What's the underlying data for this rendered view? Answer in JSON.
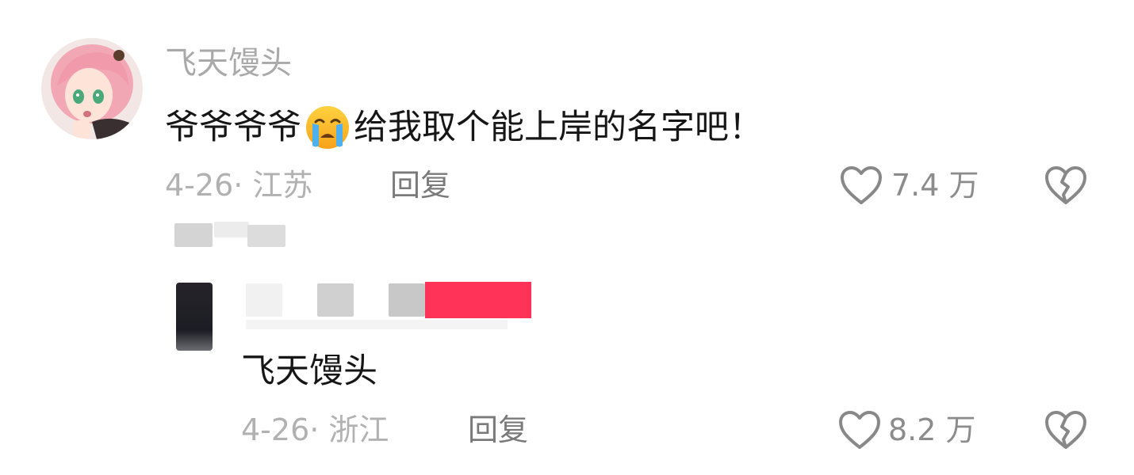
{
  "comment": {
    "username": "飞天馒头",
    "text_before": "爷爷爷爷",
    "emoji": "crying-face-emoji",
    "text_after": "给我取个能上岸的名字吧！",
    "date_location": "4-26· 江苏",
    "reply_label": "回复",
    "like_count": "7.4 万"
  },
  "reply": {
    "text": "飞天馒头",
    "date_location": "4-26· 浙江",
    "reply_label": "回复",
    "like_count": "8.2 万"
  },
  "colors": {
    "accent_pink": "#ff3357",
    "text_primary": "#161616",
    "text_muted": "#a9a9a9"
  }
}
